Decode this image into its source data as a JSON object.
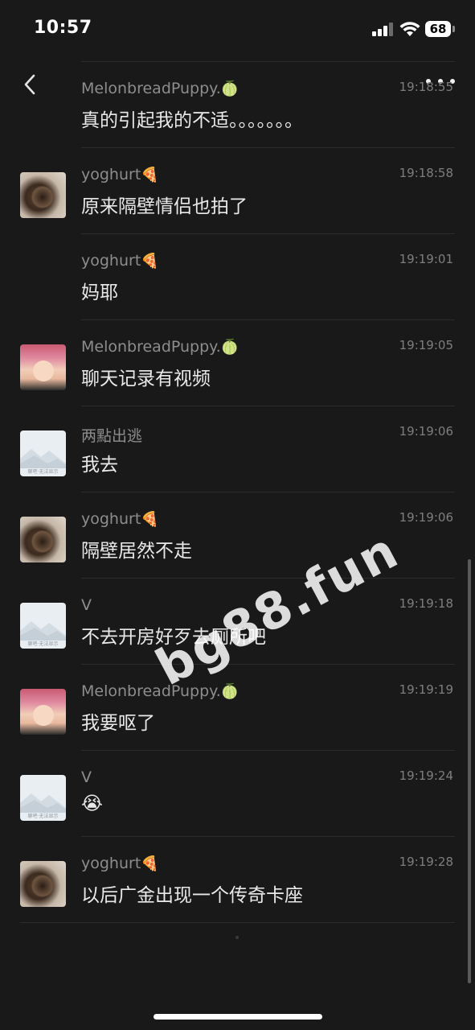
{
  "status_bar": {
    "time": "10:57",
    "battery": "68"
  },
  "nav": {
    "back_icon": "chevron-left-icon",
    "more_icon": "more-dots-icon"
  },
  "messages": [
    {
      "name": "MelonbreadPuppy.",
      "emoji": "🍈",
      "time": "19:18:55",
      "text": "真的引起我的不适。。。。。。。",
      "avatar": "none"
    },
    {
      "name": "yoghurt",
      "emoji": "🍕",
      "time": "19:18:58",
      "text": "原来隔壁情侣也拍了",
      "avatar": "dog"
    },
    {
      "name": "yoghurt",
      "emoji": "🍕",
      "time": "19:19:01",
      "text": "妈耶",
      "avatar": "none"
    },
    {
      "name": "MelonbreadPuppy.",
      "emoji": "🍈",
      "time": "19:19:05",
      "text": "聊天记录有视频",
      "avatar": "boy"
    },
    {
      "name": "两點出逃",
      "emoji": "",
      "time": "19:19:06",
      "text": "我去",
      "avatar": "default"
    },
    {
      "name": "yoghurt",
      "emoji": "🍕",
      "time": "19:19:06",
      "text": "隔壁居然不走",
      "avatar": "dog"
    },
    {
      "name": "V",
      "emoji": "",
      "time": "19:19:18",
      "text": "不去开房好歹去厕所吧",
      "avatar": "default"
    },
    {
      "name": "MelonbreadPuppy.",
      "emoji": "🍈",
      "time": "19:19:19",
      "text": "我要呕了",
      "avatar": "boy"
    },
    {
      "name": "V",
      "emoji": "",
      "time": "19:19:24",
      "text": "😭",
      "avatar": "default"
    },
    {
      "name": "yoghurt",
      "emoji": "🍕",
      "time": "19:19:28",
      "text": "以后广金出现一个传奇卡座",
      "avatar": "dog"
    }
  ],
  "default_avatar_caption": "聊吧·无法显示",
  "watermark": "bg88.fun"
}
